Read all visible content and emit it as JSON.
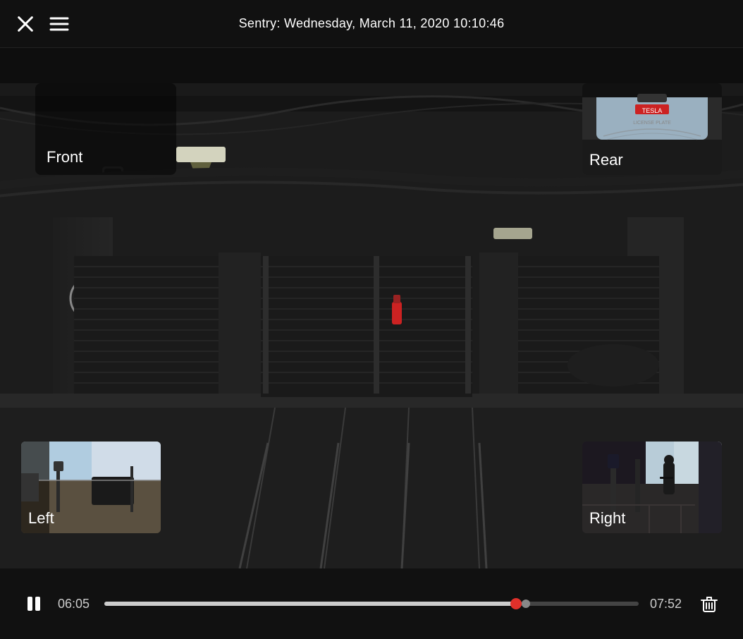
{
  "header": {
    "title": "Sentry: Wednesday, March 11, 2020 10:10:46",
    "close_label": "×",
    "menu_label": "☰"
  },
  "cameras": {
    "front": {
      "label": "Front"
    },
    "rear": {
      "label": "Rear"
    },
    "left": {
      "label": "Left"
    },
    "right": {
      "label": "Right"
    }
  },
  "controls": {
    "current_time": "06:05",
    "total_time": "07:52",
    "progress_percent": 77
  },
  "icons": {
    "close": "✕",
    "menu": "≡",
    "pause": "pause",
    "delete": "trash"
  }
}
